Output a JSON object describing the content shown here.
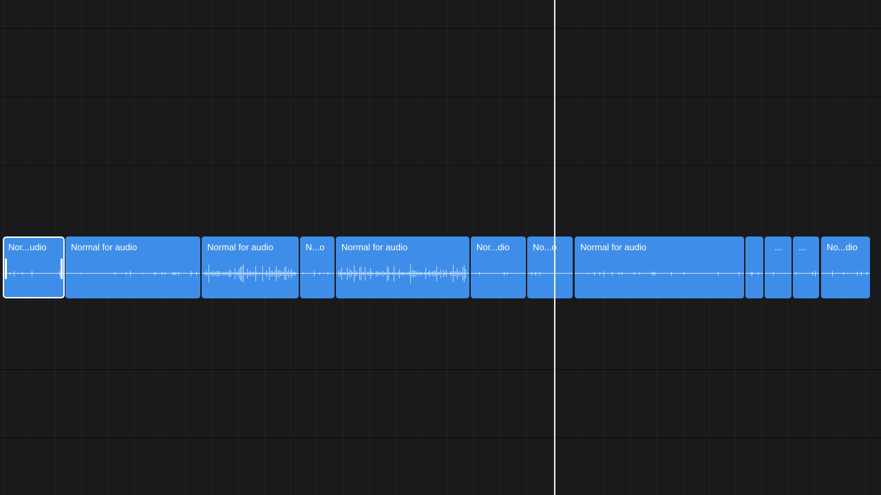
{
  "timeline": {
    "playhead_color": "#f3f3f3",
    "clip_color": "#3e8ee9",
    "background_color": "#1a1a1c"
  },
  "clips": [
    {
      "title": "Nor...udio",
      "selected": true
    },
    {
      "title": "Normal for audio",
      "selected": false
    },
    {
      "title": "Normal for audio",
      "selected": false
    },
    {
      "title": "N...o",
      "selected": false
    },
    {
      "title": "Normal for audio",
      "selected": false
    },
    {
      "title": "Nor...dio",
      "selected": false
    },
    {
      "title": "No...o",
      "selected": false
    },
    {
      "title": "Normal for audio",
      "selected": false
    },
    {
      "title": "",
      "selected": false
    },
    {
      "title": "...",
      "selected": false
    },
    {
      "title": "...",
      "selected": false
    },
    {
      "title": "No...dio",
      "selected": false
    }
  ]
}
